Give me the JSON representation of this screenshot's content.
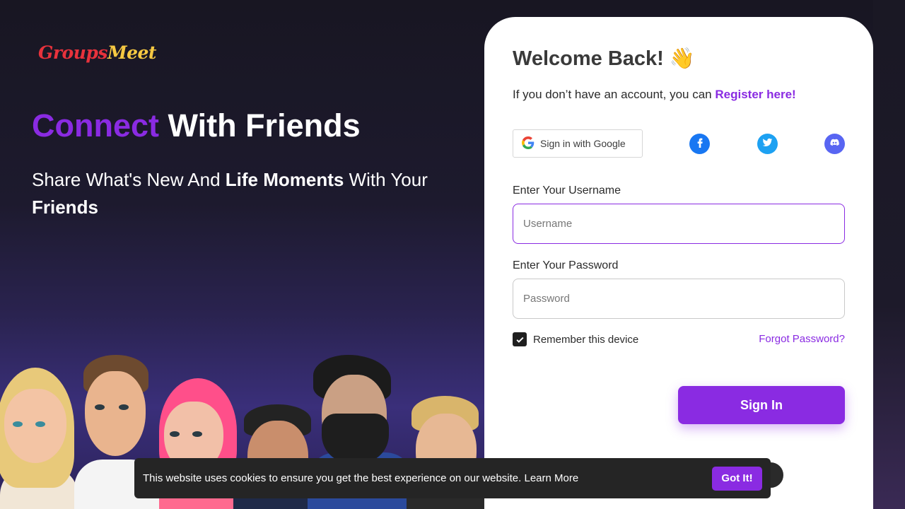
{
  "brand": {
    "part1": "Groups",
    "part2": "Meet"
  },
  "hero": {
    "title_accent": "Connect",
    "title_rest": "With Friends",
    "sub_1": "Share What's New And ",
    "sub_bold1": "Life Moments",
    "sub_2": " With Your ",
    "sub_bold2": "Friends"
  },
  "login": {
    "welcome": "Welcome Back! 👋",
    "register_prefix": "If you don’t have an account, you can ",
    "register_link": "Register here!",
    "google_label": "Sign in with Google",
    "username_label": "Enter Your Username",
    "username_placeholder": "Username",
    "password_label": "Enter Your Password",
    "password_placeholder": "Password",
    "remember_label": "Remember this device",
    "remember_checked": true,
    "forgot_label": "Forgot Password?",
    "signin_label": "Sign In"
  },
  "cookie": {
    "text": "This website uses cookies to ensure you get the best experience on our website. Learn More",
    "button": "Got It!"
  },
  "colors": {
    "accent": "#8a2be2",
    "facebook": "#1877f2",
    "twitter": "#1da1f2",
    "discord": "#5865f2"
  },
  "icons": {
    "facebook": "facebook-icon",
    "twitter": "twitter-icon",
    "discord": "discord-icon",
    "google": "google-icon",
    "check": "check-icon"
  }
}
